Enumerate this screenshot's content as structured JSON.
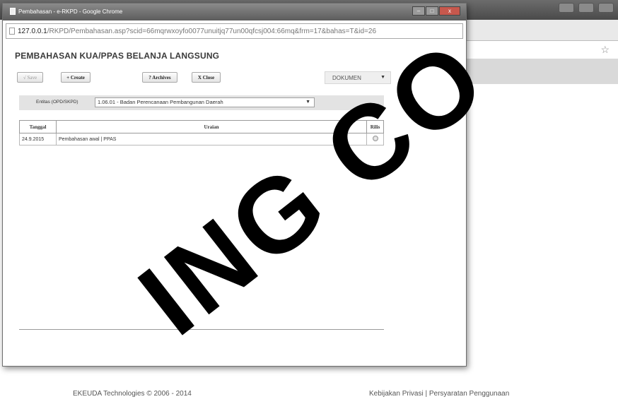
{
  "browser": {
    "window_title": "Pembahasan - e-RKPD - Google Chrome",
    "address_host": "127.0.0.1",
    "address_path": "/RKPD/Pembahasan.asp?scid=66mqrwxoyfo0077unuitjq77un00qfcsj004:66mq&frm=17&bahas=T&id=26"
  },
  "page": {
    "heading": "PEMBAHASAN KUA/PPAS BELANJA LANGSUNG"
  },
  "toolbar": {
    "save_label": "√ Save",
    "create_label": "+ Create",
    "archives_label": "? Archives",
    "close_label": "X Close",
    "dokumen_label": "DOKUMEN"
  },
  "filter": {
    "label": "Entitas (OPD/SKPD)",
    "selected": "1.06.01 - Badan Perencanaan Pembangunan Daerah"
  },
  "table": {
    "headers": [
      "Tanggal",
      "Uraian",
      "Rilis"
    ],
    "rows": [
      {
        "tanggal": "24.9.2015",
        "uraian": "Pembahasan awal | PPAS"
      }
    ]
  },
  "footer": {
    "copyright": "EKEUDA Technologies © 2006 - 2014",
    "links": "Kebijakan Privasi | Persyaratan Penggunaan"
  },
  "watermark": {
    "text": "ING CO"
  }
}
